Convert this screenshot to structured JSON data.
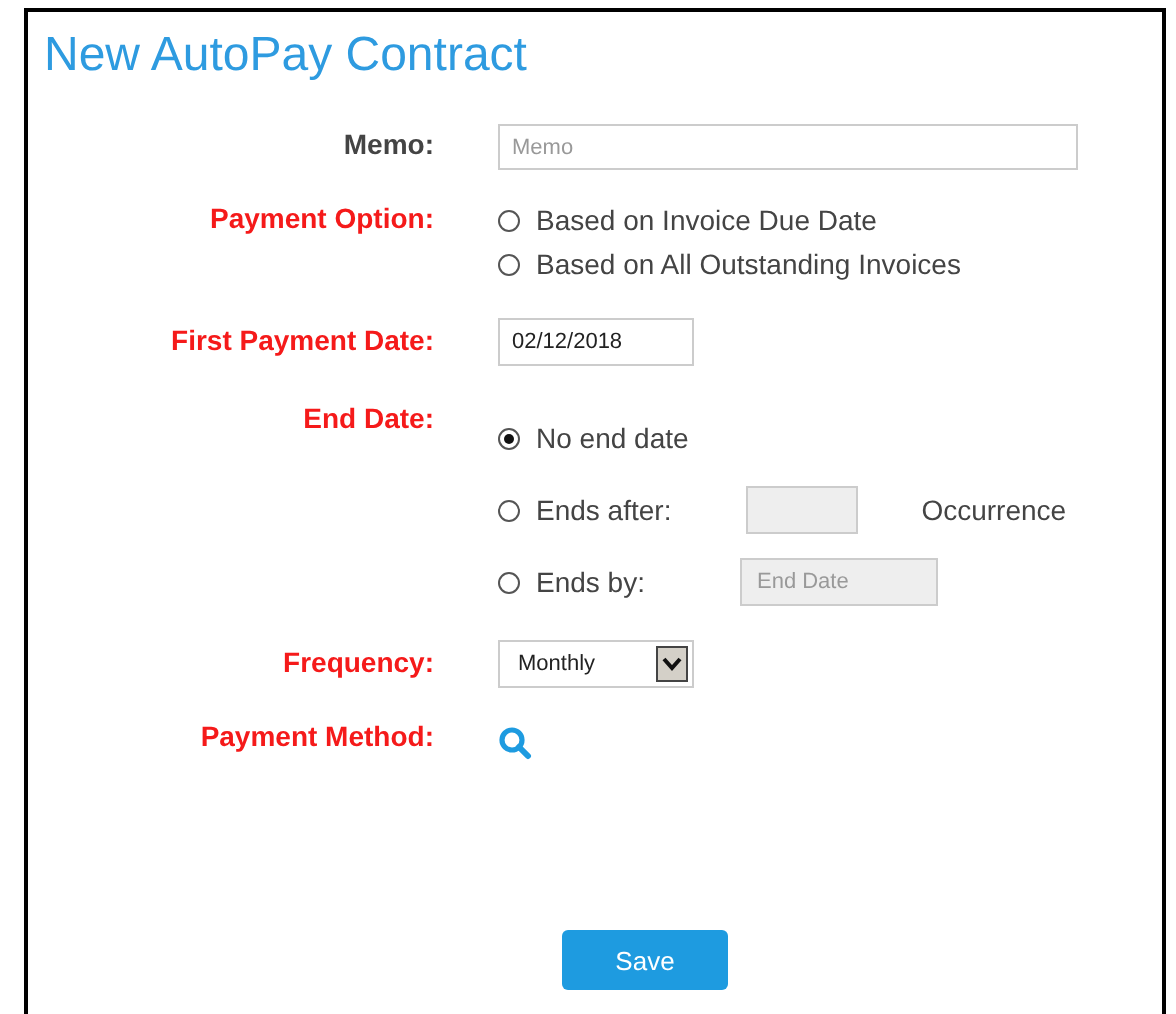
{
  "title": "New AutoPay Contract",
  "fields": [
    {
      "kind": "text",
      "label": "Memo:",
      "required": false,
      "placeholder": "Memo"
    },
    {
      "kind": "radio",
      "label": "Payment Option:",
      "required": true,
      "options": [
        {
          "label": "Based on Invoice Due Date",
          "selected": false
        },
        {
          "label": "Based on All Outstanding Invoices",
          "selected": false
        }
      ]
    },
    {
      "kind": "date",
      "label": "First Payment Date:",
      "required": true,
      "value": "02/12/2018"
    },
    {
      "kind": "end",
      "label": "End Date:",
      "required": true,
      "options": [
        {
          "kind": "plain",
          "label": "No end date",
          "selected": true
        },
        {
          "kind": "count",
          "label": "Ends after:",
          "selected": false,
          "suffix": "Occurrence"
        },
        {
          "kind": "date",
          "label": "Ends by:",
          "selected": false,
          "placeholder": "End Date"
        }
      ]
    },
    {
      "kind": "select",
      "label": "Frequency:",
      "required": true,
      "value": "Monthly"
    },
    {
      "kind": "lookup",
      "label": "Payment Method:",
      "required": true
    }
  ],
  "save": "Save"
}
